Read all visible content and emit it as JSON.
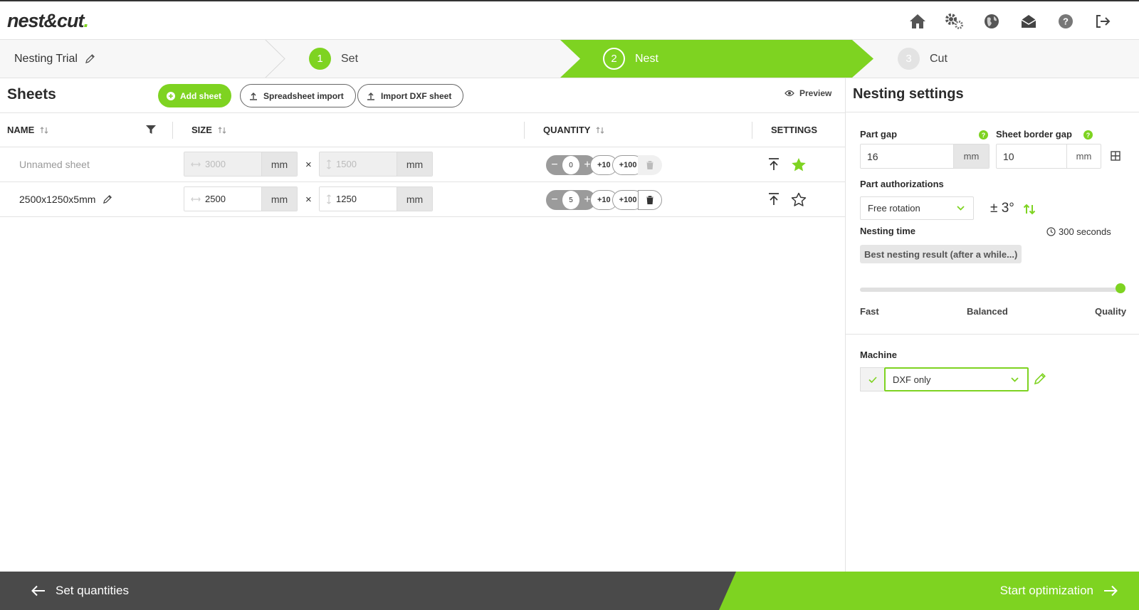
{
  "header": {
    "logo": {
      "part1": "nest",
      "amp": "&",
      "part2": "cut",
      "dot": "."
    },
    "icons": [
      "home-icon",
      "settings-icon",
      "globe-icon",
      "mail-icon",
      "help-icon",
      "logout-icon"
    ]
  },
  "stepper": {
    "project_name": "Nesting Trial",
    "steps": [
      {
        "num": "1",
        "label": "Set"
      },
      {
        "num": "2",
        "label": "Nest"
      },
      {
        "num": "3",
        "label": "Cut"
      }
    ]
  },
  "sheets": {
    "title": "Sheets",
    "add_label": "Add sheet",
    "spreadsheet_label": "Spreadsheet import",
    "dxf_label": "Import DXF sheet",
    "preview_label": "Preview",
    "columns": {
      "name": "NAME",
      "size": "SIZE",
      "quantity": "QUANTITY",
      "settings": "SETTINGS"
    },
    "rows": [
      {
        "name": "Unnamed sheet",
        "width": "3000",
        "height": "1500",
        "unit": "mm",
        "qty": "0",
        "favorite": true,
        "disabled": true
      },
      {
        "name": "2500x1250x5mm",
        "width": "2500",
        "height": "1250",
        "unit": "mm",
        "qty": "5",
        "favorite": false,
        "disabled": false
      }
    ],
    "times": "×",
    "plus10": "+10",
    "plus100": "+100"
  },
  "settings": {
    "title": "Nesting settings",
    "part_gap_label": "Part gap",
    "part_gap_value": "16",
    "part_gap_unit": "mm",
    "border_gap_label": "Sheet border gap",
    "border_gap_value": "10",
    "border_gap_unit": "mm",
    "help": "?",
    "auth_label": "Part authorizations",
    "auth_value": "Free rotation",
    "rotation_tolerance": "± 3°",
    "nesting_time_label": "Nesting time",
    "nesting_seconds": "300 seconds",
    "nesting_mode": "Best nesting result (after a while...)",
    "slider_value": 1.0,
    "slider_labels": {
      "fast": "Fast",
      "balanced": "Balanced",
      "quality": "Quality"
    },
    "machine_label": "Machine",
    "machine_value": "DXF only"
  },
  "footer": {
    "back_label": "Set quantities",
    "start_label": "Start optimization"
  },
  "colors": {
    "accent": "#7ed321",
    "footer": "#4a4a4a",
    "text": "#2b2b2b"
  }
}
